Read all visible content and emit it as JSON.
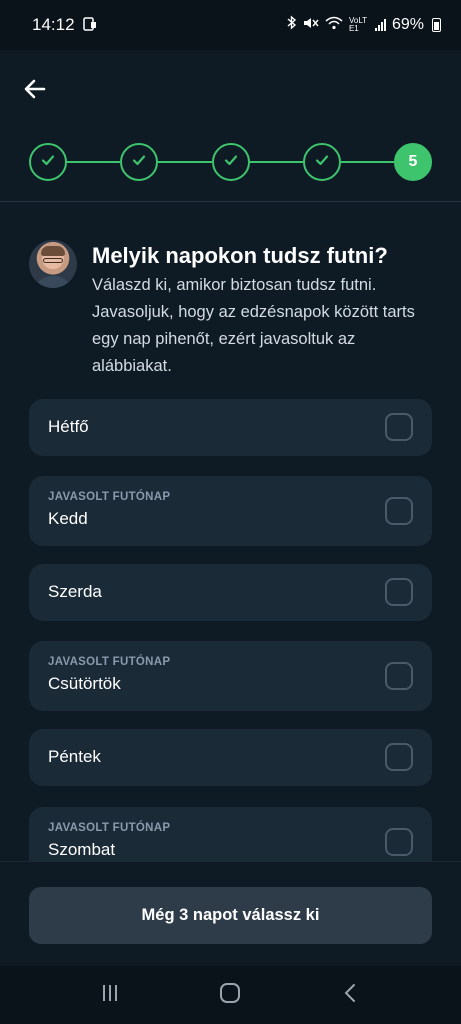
{
  "status_bar": {
    "time": "14:12",
    "battery_text": "69%",
    "network_label": "VoLTE1"
  },
  "header": {
    "back_icon": "arrow-left-icon",
    "steps": [
      {
        "state": "done"
      },
      {
        "state": "done"
      },
      {
        "state": "done"
      },
      {
        "state": "done"
      },
      {
        "state": "active",
        "label": "5"
      }
    ]
  },
  "intro": {
    "title": "Melyik napokon tudsz futni?",
    "description": "Válaszd ki, amikor biztosan tudsz futni. Javasoljuk, hogy az edzésnapok között tarts egy nap pihenőt, ezért javasoltuk az alábbiakat."
  },
  "days": [
    {
      "label": "Hétfő",
      "suggested": false,
      "checked": false
    },
    {
      "label": "Kedd",
      "suggested": true,
      "tag": "JAVASOLT FUTÓNAP",
      "checked": false
    },
    {
      "label": "Szerda",
      "suggested": false,
      "checked": false
    },
    {
      "label": "Csütörtök",
      "suggested": true,
      "tag": "JAVASOLT FUTÓNAP",
      "checked": false
    },
    {
      "label": "Péntek",
      "suggested": false,
      "checked": false
    },
    {
      "label": "Szombat",
      "suggested": true,
      "tag": "JAVASOLT FUTÓNAP",
      "checked": false
    }
  ],
  "cta": {
    "label": "Még 3 napot válassz ki"
  },
  "colors": {
    "background": "#0e1a24",
    "card": "#1b2a37",
    "accent_green": "#3ec46d",
    "button": "#2e3c4a"
  }
}
